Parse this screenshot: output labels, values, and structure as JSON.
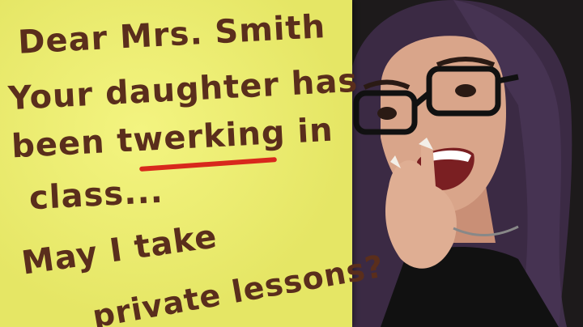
{
  "note": {
    "lines": [
      "Dear Mrs. Smith",
      "Your daughter has",
      "been twerking in",
      "class...",
      "May I take",
      "private lessons?"
    ],
    "underlined_word": "twerking",
    "paper_color": "#f1f26a",
    "ink_color": "#5a2e1c",
    "underline_color": "#d8281c"
  },
  "colors": {
    "background_accent": "#e01010",
    "hair": "#3b2a44",
    "skin": "#d9a58a"
  }
}
